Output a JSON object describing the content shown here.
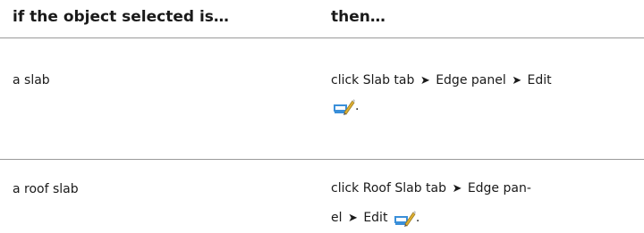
{
  "table": {
    "headers": {
      "condition": "if the object selected is…",
      "action": "then…"
    },
    "rows": [
      {
        "condition": "a slab",
        "action_prefix": "click Slab tab",
        "arrow": "➤",
        "action_middle": "Edge panel",
        "action_end": "Edit",
        "icon": "edit-edge-icon",
        "suffix": "."
      },
      {
        "condition": "a roof slab",
        "action_prefix": "click Roof Slab tab",
        "arrow": "➤",
        "action_middle": "Edge pan-",
        "action_middle_cont": "el",
        "action_end": "Edit",
        "icon": "edit-edge-icon",
        "suffix": "."
      }
    ]
  },
  "colors": {
    "rule": "#9a9a9a",
    "text": "#1a1a1a",
    "icon_blue": "#3a8fd9",
    "icon_pencil": "#e0b030"
  }
}
